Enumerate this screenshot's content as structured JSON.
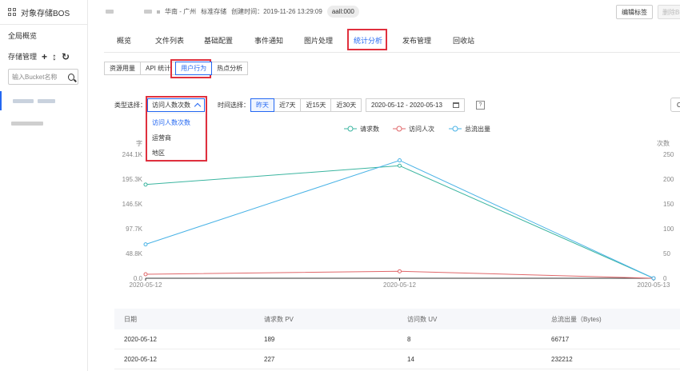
{
  "sidebar": {
    "title": "对象存储BOS",
    "overview": "全局概览",
    "storage_manage": "存储管理",
    "search_placeholder": "输入Bucket名称"
  },
  "header": {
    "region": "华南 - 广州",
    "storage_class": "标准存储",
    "created": "创建时间：2019-11-26 13:29:09",
    "acl_badge": "aall:000",
    "edit_tags": "编辑标签",
    "delete": "删除Bucket"
  },
  "tabs": [
    "概览",
    "文件列表",
    "基础配置",
    "事件通知",
    "图片处理",
    "统计分析",
    "发布管理",
    "回收站"
  ],
  "active_tab": "统计分析",
  "subtabs": [
    "资源用量",
    "API 统计",
    "用户行为",
    "热点分析"
  ],
  "active_subtab": "用户行为",
  "filters": {
    "type_label": "类型选择：",
    "type_value": "访问人数次数",
    "type_options": [
      "访问人数次数",
      "运营商",
      "地区"
    ],
    "time_label": "时间选择：",
    "time_buttons": [
      "昨天",
      "近7天",
      "近15天",
      "近30天"
    ],
    "time_active": "昨天",
    "date_range": "2020-05-12 - 2020-05-13",
    "help": "?",
    "right_stub": "C"
  },
  "chart_data": {
    "type": "line",
    "left_axis_label": "字",
    "right_axis_label": "次数",
    "x": [
      "2020-05-12",
      "2020-05-12",
      "2020-05-13"
    ],
    "left_ticks": [
      "0.0",
      "48.8K",
      "97.7K",
      "146.5K",
      "195.3K",
      "244.1K"
    ],
    "right_ticks": [
      "0",
      "50",
      "100",
      "150",
      "200",
      "250"
    ],
    "left_ylim": [
      0,
      244.1
    ],
    "right_ylim": [
      0,
      250
    ],
    "series": [
      {
        "name": "请求数",
        "axis": "right",
        "color": "#3bb5a0",
        "values": [
          189,
          227,
          0
        ]
      },
      {
        "name": "访问人次",
        "axis": "right",
        "color": "#e0676a",
        "values": [
          8,
          14,
          0
        ]
      },
      {
        "name": "总流出量",
        "axis": "left",
        "color": "#4ab3e6",
        "values": [
          66.7,
          232.2,
          0
        ]
      }
    ],
    "legend_position": "top-center",
    "grid": false
  },
  "table": {
    "headers": [
      "日期",
      "请求数 PV",
      "访问数 UV",
      "总流出量（Bytes)"
    ],
    "rows": [
      [
        "2020-05-12",
        "189",
        "8",
        "66717"
      ],
      [
        "2020-05-12",
        "227",
        "14",
        "232212"
      ]
    ]
  },
  "colors": {
    "accent": "#2468f2",
    "highlight": "#e0303e"
  }
}
